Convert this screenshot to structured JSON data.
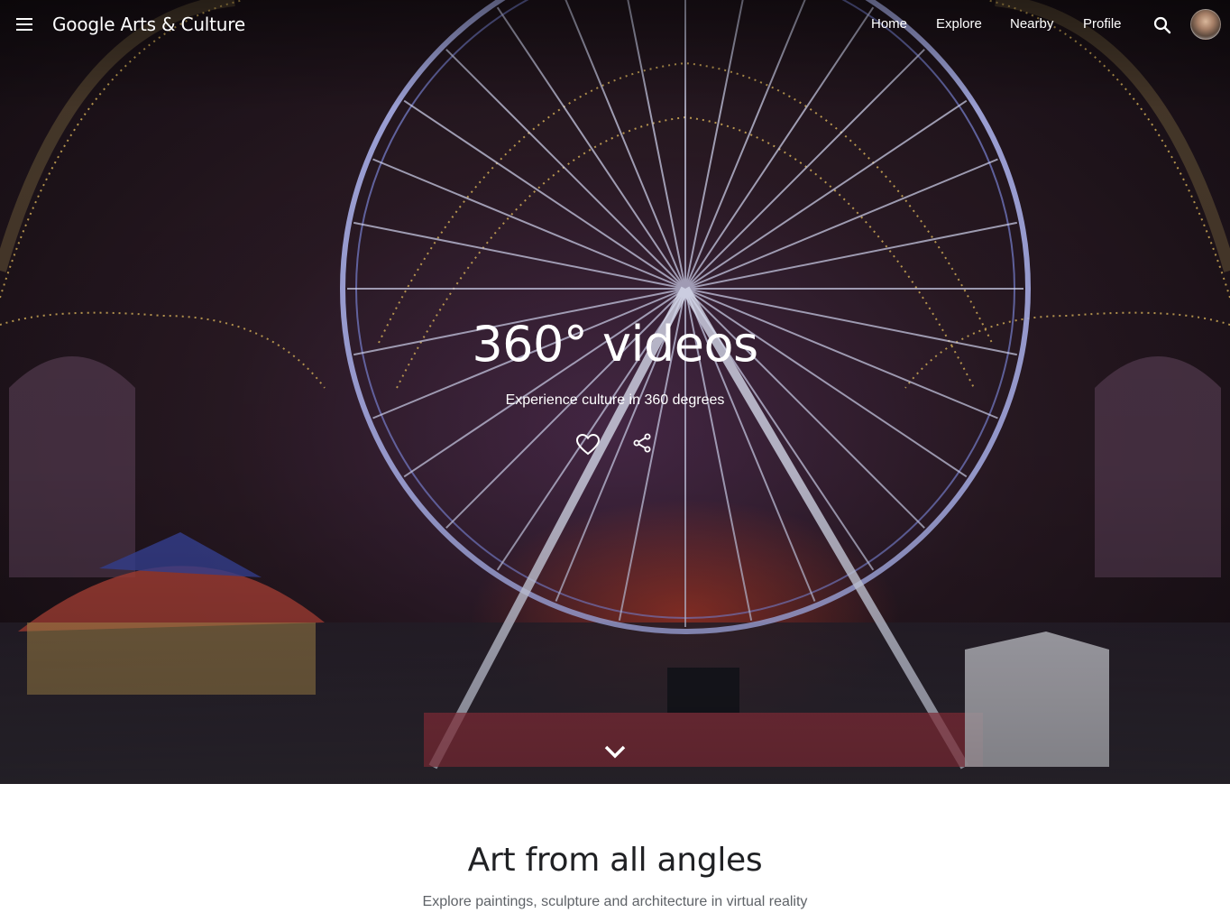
{
  "header": {
    "logo": "Google Arts & Culture",
    "nav": [
      "Home",
      "Explore",
      "Nearby",
      "Profile"
    ],
    "menu_icon": "hamburger-menu-icon",
    "search_icon": "search-icon",
    "avatar": "user-avatar"
  },
  "hero": {
    "title": "360° videos",
    "subtitle": "Experience culture in 360 degrees",
    "like_icon": "heart-icon",
    "share_icon": "share-icon",
    "scroll_icon": "chevron-down-icon"
  },
  "section": {
    "title": "Art from all angles",
    "subtitle": "Explore paintings, sculpture and architecture in virtual reality"
  },
  "colors": {
    "hero_text": "#ffffff",
    "section_title": "#202124",
    "section_subtitle": "#5f6368"
  }
}
